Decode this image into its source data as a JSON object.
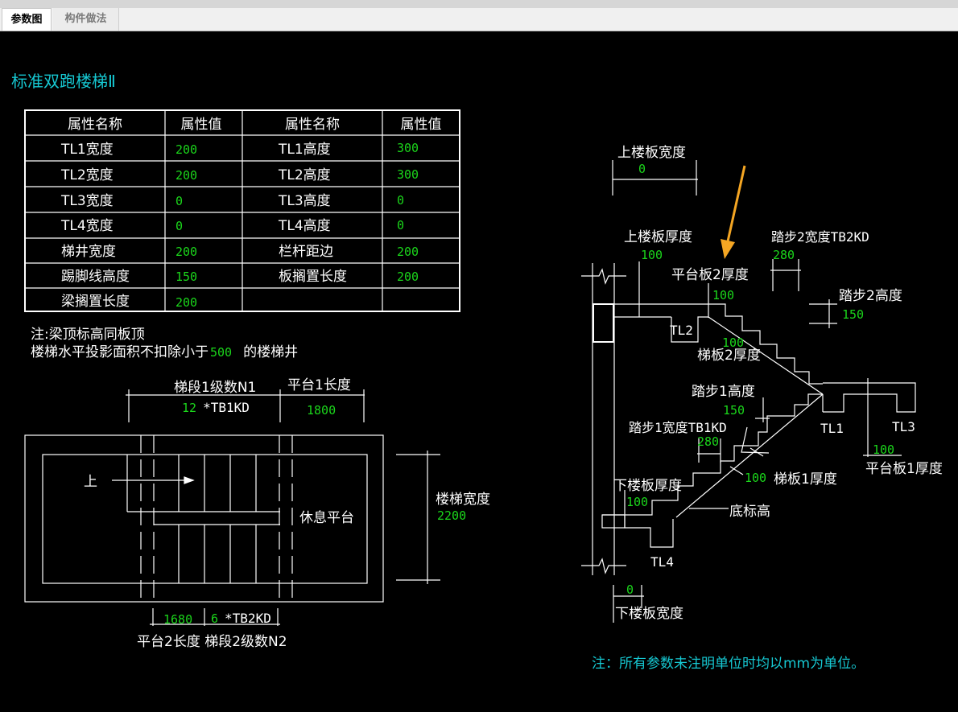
{
  "tabs": {
    "params": "参数图",
    "method": "构件做法"
  },
  "title": "标准双跑楼梯Ⅱ",
  "table": {
    "headers": [
      "属性名称",
      "属性值",
      "属性名称",
      "属性值"
    ],
    "rows": [
      [
        "TL1宽度",
        "200",
        "TL1高度",
        "300"
      ],
      [
        "TL2宽度",
        "200",
        "TL2高度",
        "300"
      ],
      [
        "TL3宽度",
        "0",
        "TL3高度",
        "0"
      ],
      [
        "TL4宽度",
        "0",
        "TL4高度",
        "0"
      ],
      [
        "梯井宽度",
        "200",
        "栏杆距边",
        "200"
      ],
      [
        "踢脚线高度",
        "150",
        "板搁置长度",
        "200"
      ],
      [
        "梁搁置长度",
        "200",
        "",
        ""
      ]
    ]
  },
  "notes": {
    "line1": "注:梁顶标高同板顶",
    "line2_prefix": "楼梯水平投影面积不扣除小于",
    "line2_value": "500",
    "line2_suffix": "的楼梯井"
  },
  "plan": {
    "seg1_label": "梯段1级数N1",
    "seg1_value": "12",
    "seg1_suffix": "*TB1KD",
    "platform1_label": "平台1长度",
    "platform1_value": "1800",
    "up_label": "上",
    "rest_label": "休息平台",
    "width_label": "楼梯宽度",
    "width_value": "2200",
    "platform2_value": "1680",
    "seg2_value": "6",
    "seg2_suffix": "*TB2KD",
    "bottom_labels": "平台2长度 梯段2级数N2"
  },
  "section": {
    "upper_slab_width_label": "上楼板宽度",
    "upper_slab_width_value": "0",
    "upper_slab_thk_label": "上楼板厚度",
    "upper_slab_thk_value": "100",
    "platform2_thk_label": "平台板2厚度",
    "platform2_thk_value": "100",
    "step2_width_label": "踏步2宽度TB2KD",
    "step2_width_value": "280",
    "step2_height_label": "踏步2高度",
    "step2_height_value": "150",
    "tl2": "TL2",
    "flight2_thk_value": "100",
    "flight2_thk_label": "梯板2厚度",
    "step1_height_label": "踏步1高度",
    "step1_height_value": "150",
    "step1_width_label": "踏步1宽度TB1KD",
    "step1_width_value": "280",
    "tl1": "TL1",
    "tl3": "TL3",
    "platform1_thk_value": "100",
    "platform1_thk_label": "平台板1厚度",
    "flight1_thk_value": "100",
    "flight1_thk_label": "梯板1厚度",
    "lower_slab_thk_label": "下楼板厚度",
    "lower_slab_thk_value": "100",
    "bottom_elev_label": "底标高",
    "tl4": "TL4",
    "lower_slab_width_value": "0",
    "lower_slab_width_label": "下楼板宽度"
  },
  "footer_note": "注：所有参数未注明单位时均以mm为单位。",
  "colors": {
    "background": "#000000",
    "lines": "#ffffff",
    "values": "#1bd61b",
    "title": "#16c8d2",
    "arrow": "#f5a623"
  }
}
